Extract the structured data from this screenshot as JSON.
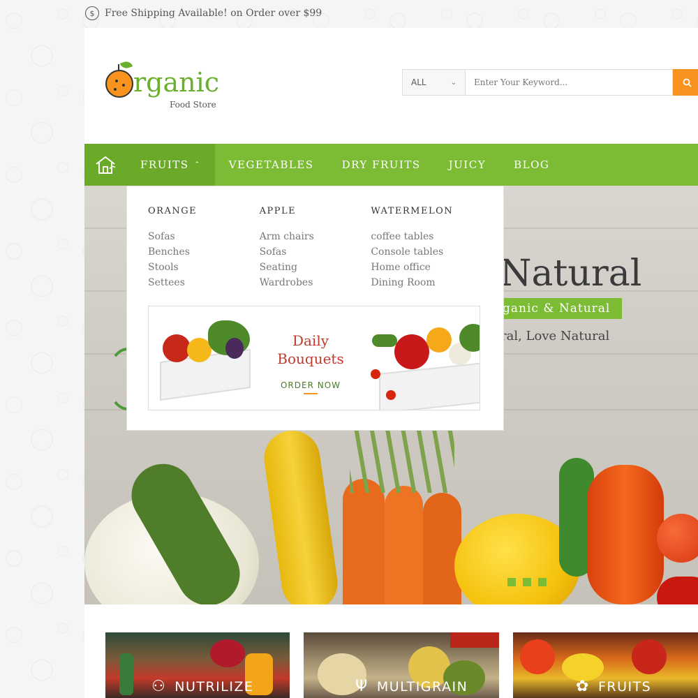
{
  "topbar": {
    "shipping_text": "Free Shipping Available! on Order over $99",
    "icon": "dollar-icon",
    "icon_glyph": "$"
  },
  "logo": {
    "word": "rganic",
    "tagline": "Food Store"
  },
  "search": {
    "category_value": "ALL",
    "placeholder": "Enter Your Keyword...",
    "button_icon": "search-icon"
  },
  "nav": {
    "home_icon": "home-icon",
    "items": [
      {
        "label": "FRUITS"
      },
      {
        "label": "VEGETABLES"
      },
      {
        "label": "DRY FRUITS"
      },
      {
        "label": "JUICY"
      },
      {
        "label": "BLOG"
      }
    ]
  },
  "mega_menu": {
    "columns": [
      {
        "heading": "ORANGE",
        "links": [
          "Sofas",
          "Benches",
          "Stools",
          "Settees"
        ]
      },
      {
        "heading": "APPLE",
        "links": [
          "Arm chairs",
          "Sofas",
          "Seating",
          "Wardrobes"
        ]
      },
      {
        "heading": "WATERMELON",
        "links": [
          "coffee tables",
          "Console tables",
          "Home office",
          "Dining Room"
        ]
      }
    ],
    "banner": {
      "title_line1": "Daily",
      "title_line2": "Bouquets",
      "cta": "ORDER NOW"
    }
  },
  "hero": {
    "title": "Natural",
    "badge": "ganic & Natural",
    "subtitle": "ral, Love Natural",
    "slide_count": 3
  },
  "categories": [
    {
      "label": "NUTRILIZE",
      "icon": "bottle-icon"
    },
    {
      "label": "MULTIGRAIN",
      "icon": "wheat-icon"
    },
    {
      "label": "FRUITS",
      "icon": "cherry-icon"
    }
  ],
  "colors": {
    "accent_green": "#7cbb34",
    "dark_green": "#6aaa28",
    "orange": "#f7931e"
  }
}
